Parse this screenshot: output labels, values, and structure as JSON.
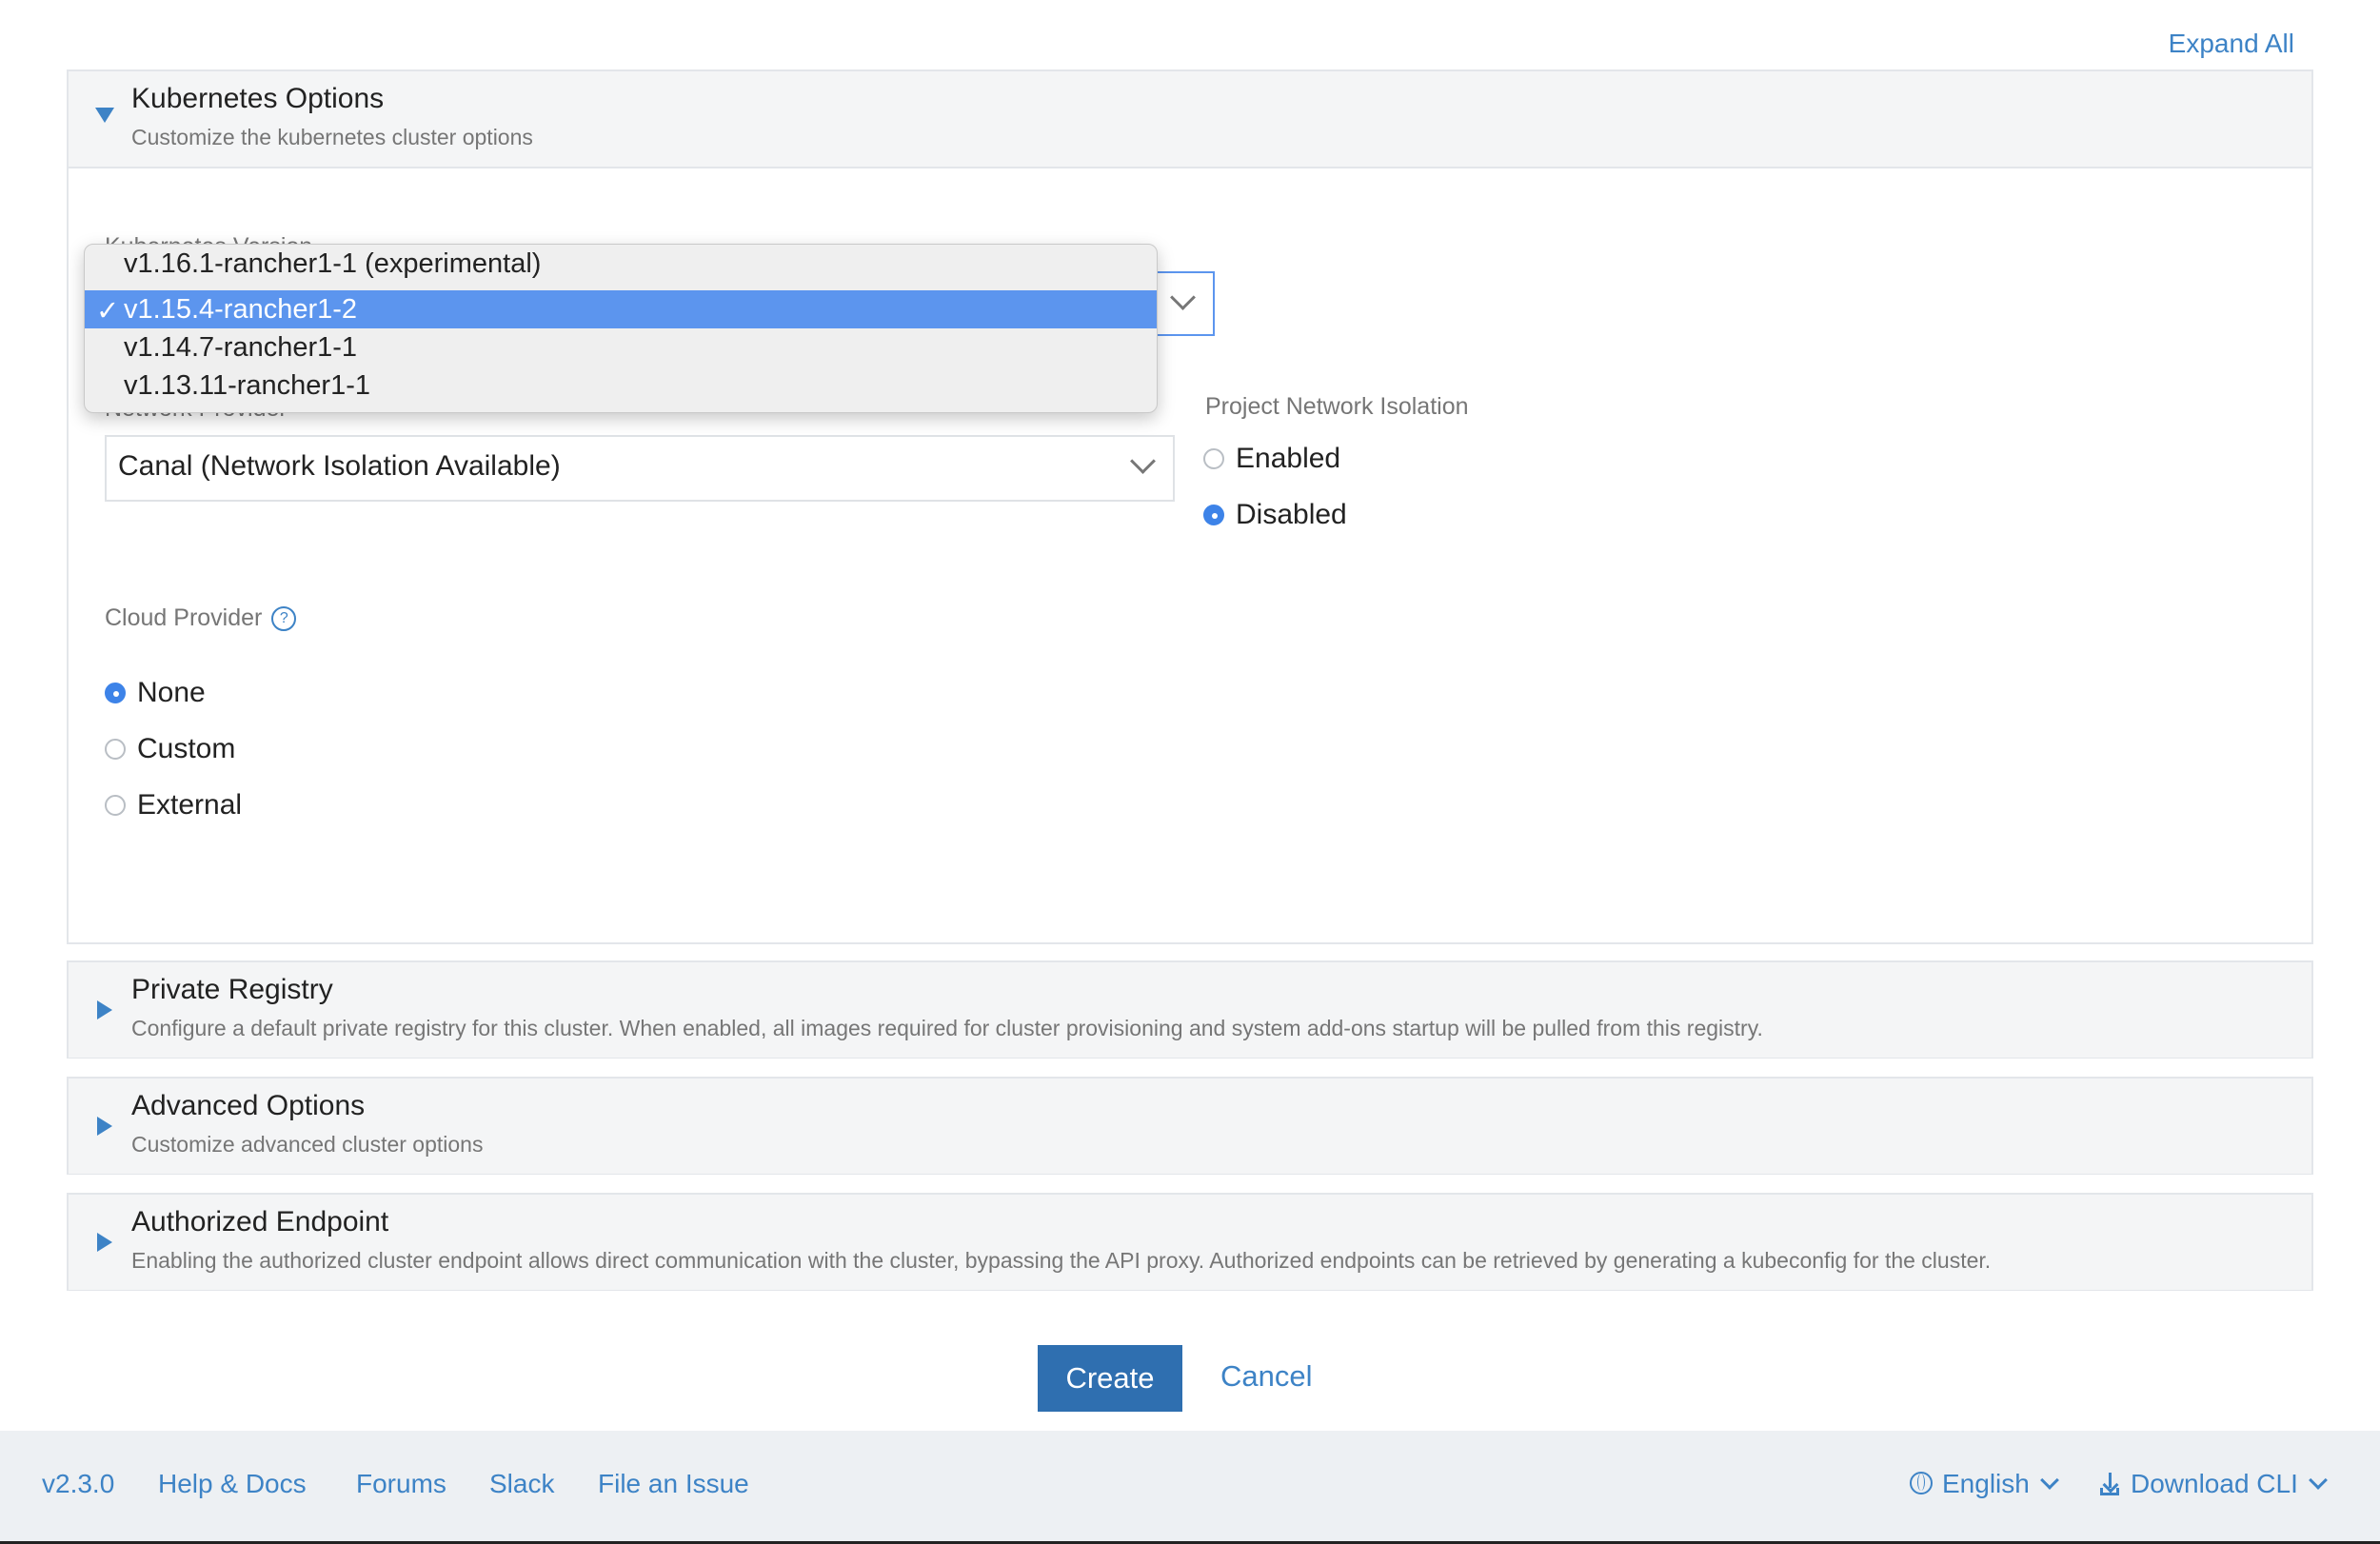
{
  "header": {
    "expand_all": "Expand All"
  },
  "kubernetes_options": {
    "title": "Kubernetes Options",
    "description": "Customize the kubernetes cluster options",
    "kubernetes_version_label": "Kubernetes Version",
    "version_options": [
      {
        "label": "v1.16.1-rancher1-1 (experimental)",
        "selected": false
      },
      {
        "label": "v1.15.4-rancher1-2",
        "selected": true
      },
      {
        "label": "v1.14.7-rancher1-1",
        "selected": false
      },
      {
        "label": "v1.13.11-rancher1-1",
        "selected": false
      }
    ],
    "network_provider_label": "Network Provider",
    "network_provider_value": "Canal (Network Isolation Available)",
    "project_network_isolation_label": "Project Network Isolation",
    "isolation_options": [
      {
        "label": "Enabled",
        "selected": false
      },
      {
        "label": "Disabled",
        "selected": true
      }
    ],
    "cloud_provider_label": "Cloud Provider",
    "cloud_provider_options": [
      {
        "label": "None",
        "selected": true
      },
      {
        "label": "Custom",
        "selected": false
      },
      {
        "label": "External",
        "selected": false
      }
    ]
  },
  "private_registry": {
    "title": "Private Registry",
    "description": "Configure a default private registry for this cluster. When enabled, all images required for cluster provisioning and system add-ons startup will be pulled from this registry."
  },
  "advanced_options": {
    "title": "Advanced Options",
    "description": "Customize advanced cluster options"
  },
  "authorized_endpoint": {
    "title": "Authorized Endpoint",
    "description": "Enabling the authorized cluster endpoint allows direct communication with the cluster, bypassing the API proxy. Authorized endpoints can be retrieved by generating a kubeconfig for the cluster."
  },
  "actions": {
    "create": "Create",
    "cancel": "Cancel"
  },
  "footer": {
    "version": "v2.3.0",
    "help_docs": "Help & Docs",
    "forums": "Forums",
    "slack": "Slack",
    "file_issue": "File an Issue",
    "language": "English",
    "download_cli": "Download CLI"
  },
  "colors": {
    "accent": "#3d83c6",
    "selected": "#5c95ee",
    "primary_button": "#2f6fb0"
  },
  "icons": [
    "triangle-down-icon",
    "triangle-right-icon",
    "chevron-down-icon",
    "help-icon",
    "checkmark-icon",
    "globe-icon",
    "download-icon"
  ]
}
